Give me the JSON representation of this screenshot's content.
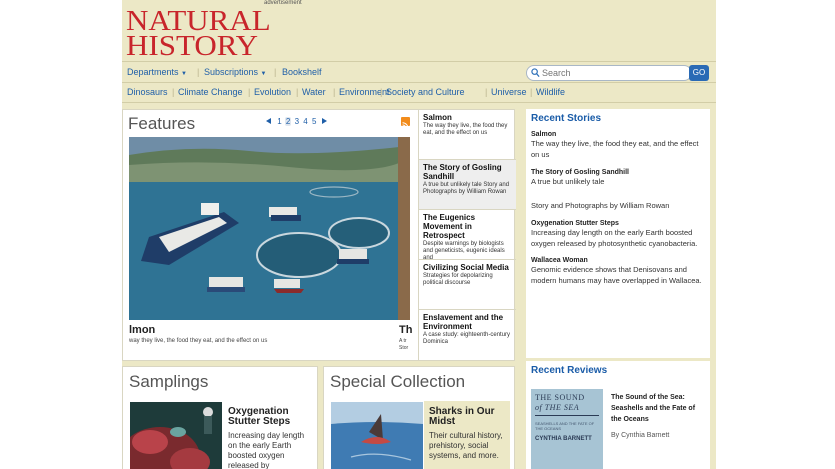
{
  "header": {
    "ad_label": "advertisement",
    "logo_line1": "NATURAL",
    "logo_line2": "HISTORY"
  },
  "nav": {
    "departments": "Departments",
    "subscriptions": "Subscriptions",
    "bookshelf": "Bookshelf",
    "search_placeholder": "Search",
    "go_label": "GO"
  },
  "topics": [
    "Dinosaurs",
    "Climate Change",
    "Evolution",
    "Water",
    "Environment",
    "Society and Culture",
    "Universe",
    "Wildlife"
  ],
  "features": {
    "title": "Features",
    "pages": [
      "1",
      "2",
      "3",
      "4",
      "5"
    ],
    "current_page": "2",
    "slide_caption": "lmon",
    "slide_sub": "way they live, the food they eat, and the effect on us",
    "peek_caption": "Th",
    "peek_sub": "A tr Stor",
    "list": [
      {
        "title": "Salmon",
        "desc": "The way they live, the food they eat, and the effect on us"
      },
      {
        "title": "The Story of Gosling Sandhill",
        "desc": "A true but unlikely tale Story and Photographs by William Rowan"
      },
      {
        "title": "The Eugenics Movement in Retrospect",
        "desc": "Despite warnings by biologists and geneticists, eugenic ideals and"
      },
      {
        "title": "Civilizing Social Media",
        "desc": "Strategies for depolarizing political discourse"
      },
      {
        "title": "Enslavement and the Environment",
        "desc": "A case study: eighteenth-century Dominica"
      }
    ]
  },
  "recent": {
    "heading": "Recent Stories",
    "items": [
      {
        "title": "Salmon",
        "desc": "The way they live, the food they eat, and the effect on us"
      },
      {
        "title": "The Story of Gosling Sandhill",
        "desc": "A true but unlikely tale"
      },
      {
        "title": "",
        "desc": "Story and Photographs by William Rowan"
      },
      {
        "title": "Oxygenation Stutter Steps",
        "desc": "Increasing day length on the early Earth boosted oxygen released by photosynthetic cyanobacteria."
      },
      {
        "title": "Wallacea Woman",
        "desc": "Genomic evidence shows that Denisovans and modern humans may have overlapped in Wallacea."
      }
    ]
  },
  "reviews": {
    "heading": "Recent Reviews",
    "book_line1": "THE SOUND",
    "book_line2": "of THE SEA",
    "book_line3": "SEASHELLS AND THE FATE OF THE OCEANS",
    "book_author_cover": "CYNTHIA BARNETT",
    "title": "The Sound of the Sea: Seashells and the Fate of the Oceans",
    "author": "By Cynthia Barnett"
  },
  "samplings": {
    "title": "Samplings",
    "head": "Oxygenation Stutter Steps",
    "desc": "Increasing day length on the early Earth boosted oxygen released by photosynthetic"
  },
  "special": {
    "title": "Special Collection",
    "head": "Sharks in Our Midst",
    "desc": "Their cultural history, prehistory, social systems, and more."
  },
  "colors": {
    "brand_red": "#c8252b",
    "link_blue": "#1f5fa8",
    "panel_bg": "#ece8c6"
  }
}
